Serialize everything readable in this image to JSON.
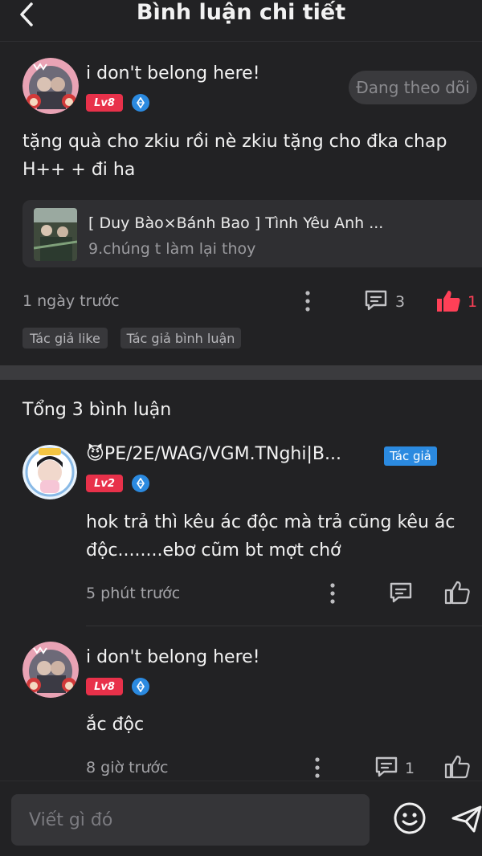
{
  "header": {
    "title": "Bình luận chi tiết"
  },
  "post": {
    "author": "i don't belong here!",
    "level": "Lv8",
    "follow_label": "Đang theo dõi",
    "text": "tặng quà cho zkiu rồi nè zkiu tặng cho đka chap H++ + đi ha",
    "linked": {
      "title": "[ Duy Bào×Bánh Bao ] Tình Yêu Anh ...",
      "subtitle": "9.chúng t làm lại thoy"
    },
    "time": "1 ngày trước",
    "comment_count": "3",
    "like_count": "1",
    "tags": [
      "Tác giả like",
      "Tác giả bình luận"
    ]
  },
  "comments_header": "Tổng 3 bình luận",
  "comments": [
    {
      "author": "😈PE/2E/WAG/VGM.TNghi|B...",
      "level": "Lv2",
      "author_tag": "Tác giả",
      "text": "hok trả thì kêu ác độc mà trả cũng kêu ác độc........ebơ cũm bt mợt chớ",
      "time": "5 phút trước"
    },
    {
      "author": "i don't belong here!",
      "level": "Lv8",
      "text": "ắc độc",
      "time": "8 giờ trước",
      "comment_count": "1"
    }
  ],
  "input": {
    "placeholder": "Viết gì đó"
  },
  "colors": {
    "accent": "#e8314a",
    "like_active": "#ff4057",
    "verify": "#2b8ae0",
    "background": "#222224"
  },
  "icons": [
    "back-arrow-icon",
    "verify-icon",
    "more-icon",
    "comment-icon",
    "thumbs-up-icon",
    "emoji-icon",
    "send-icon"
  ]
}
